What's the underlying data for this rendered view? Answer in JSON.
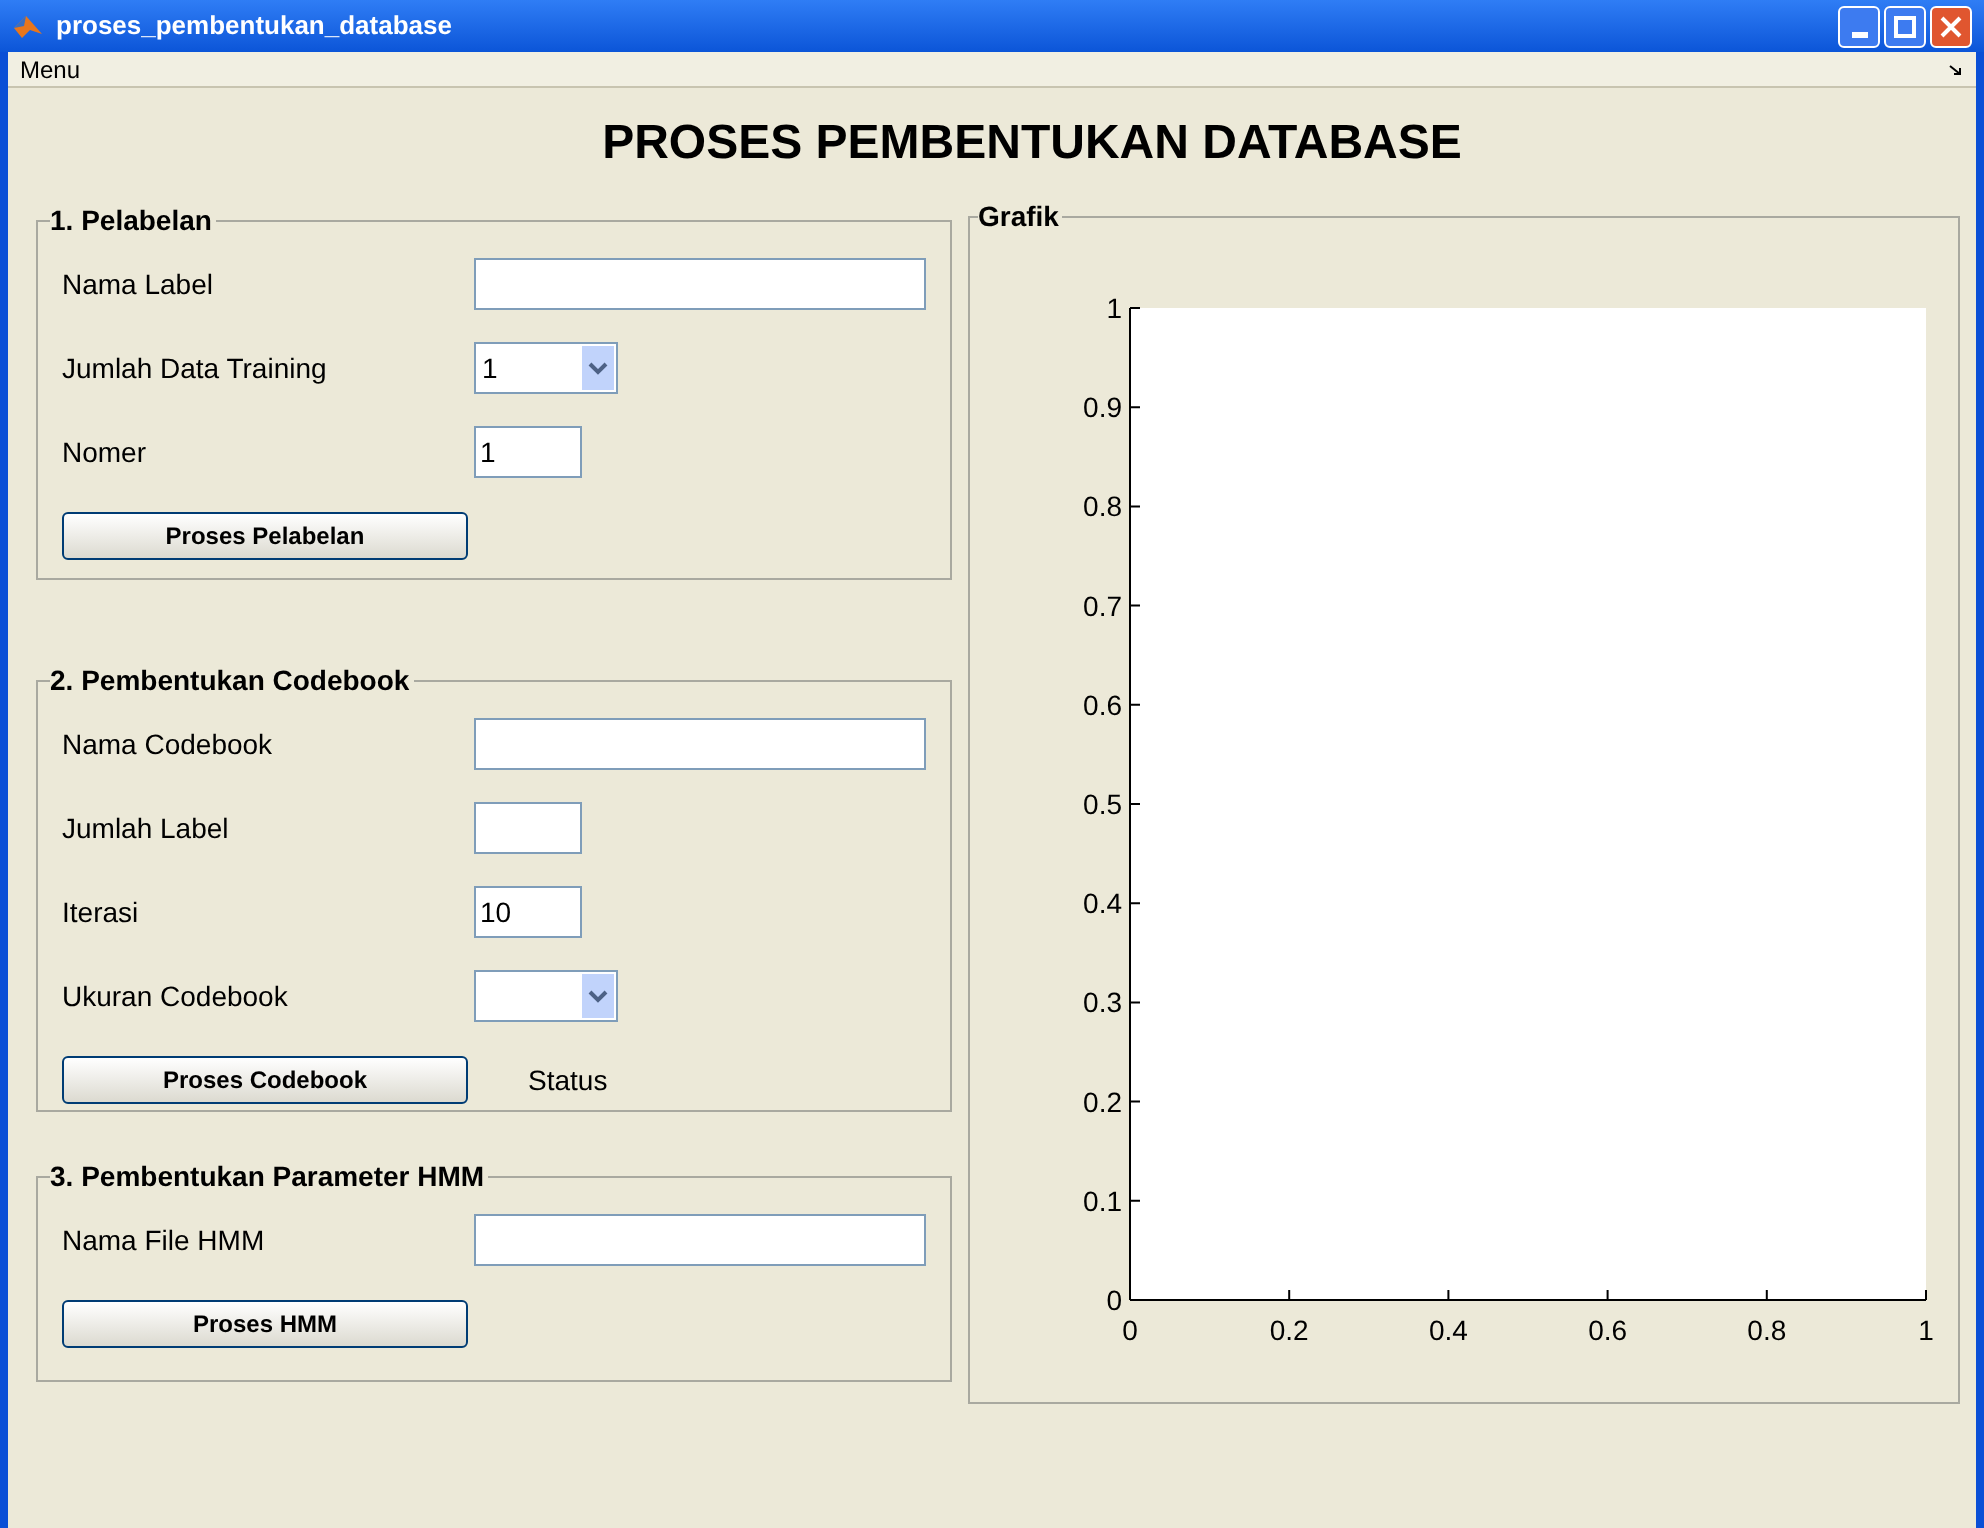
{
  "window": {
    "title": "proses_pembentukan_database"
  },
  "menu_bar": [
    "Menu"
  ],
  "heading": "PROSES PEMBENTUKAN DATABASE",
  "panels": [
    {
      "title": "1. Pelabelan",
      "rows": [
        {
          "kind": "wide_field",
          "label": "Nama Label"
        },
        {
          "kind": "dropdown",
          "label": "Jumlah Data Training",
          "value": "1"
        },
        {
          "kind": "short_field",
          "label": "Nomer",
          "value": "1"
        },
        {
          "kind": "button",
          "label": "Proses Pelabelan"
        }
      ]
    },
    {
      "title": "2. Pembentukan Codebook",
      "rows": [
        {
          "kind": "wide_field",
          "label": "Nama Codebook"
        },
        {
          "kind": "short_field",
          "label": "Jumlah Label"
        },
        {
          "kind": "short_field",
          "label": "Iterasi",
          "value": "10"
        },
        {
          "kind": "dropdown",
          "label": "Ukuran Codebook"
        },
        {
          "kind": "button",
          "label": "Proses Codebook",
          "status": "Status"
        }
      ]
    },
    {
      "title": "3. Pembentukan Parameter HMM",
      "rows": [
        {
          "kind": "wide_field",
          "label": "Nama File HMM"
        },
        {
          "kind": "button",
          "label": "Proses HMM"
        }
      ]
    }
  ],
  "graph_panel": {
    "title": "Grafik",
    "chart_data": {
      "type": "line",
      "xlim": [
        0,
        1
      ],
      "ylim": [
        0,
        1
      ],
      "xticks": [
        0,
        0.2,
        0.4,
        0.6,
        0.8,
        1
      ],
      "yticks": [
        0,
        0.1,
        0.2,
        0.3,
        0.4,
        0.5,
        0.6,
        0.7,
        0.8,
        0.9,
        1
      ]
    }
  }
}
